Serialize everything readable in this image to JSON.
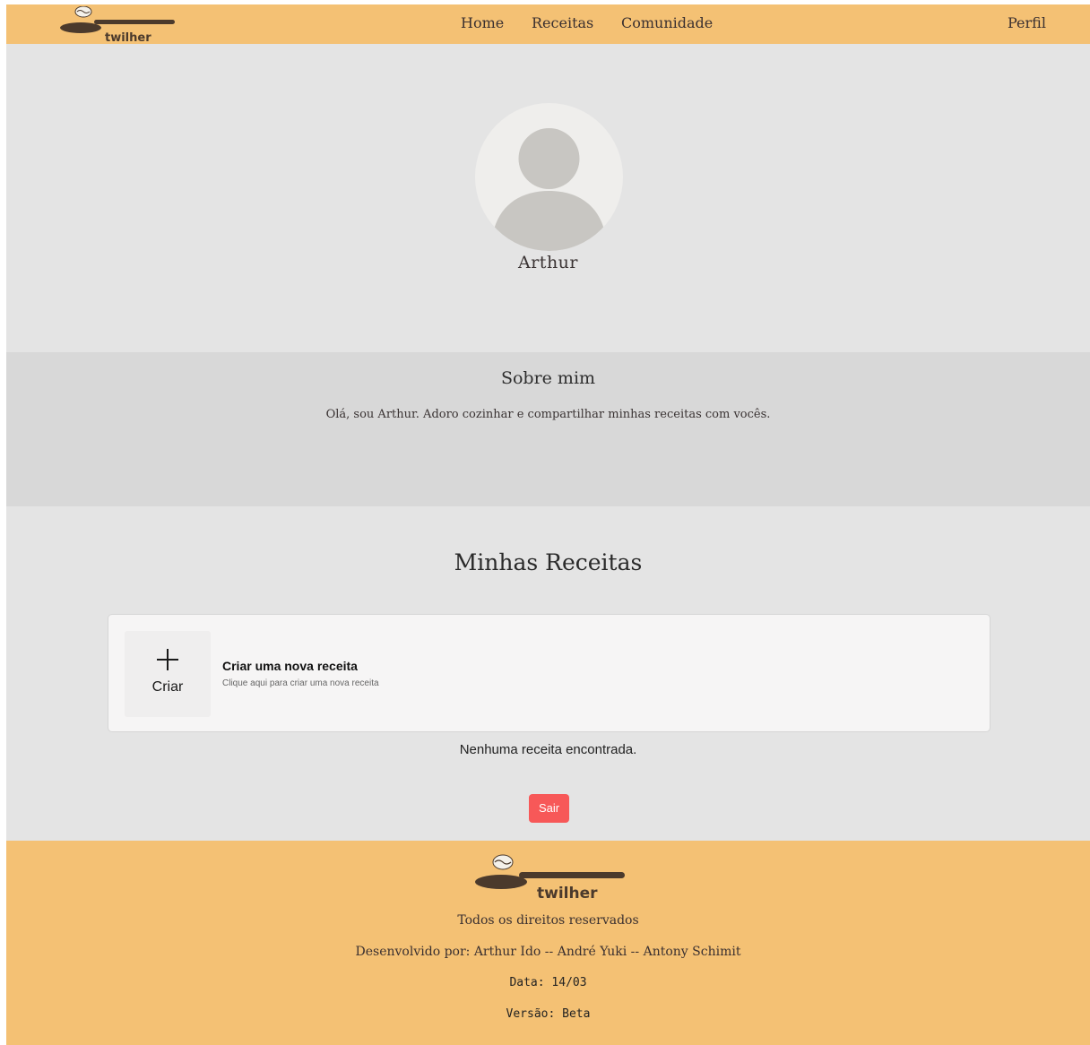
{
  "header": {
    "logo_text": "twilher",
    "nav": {
      "home": "Home",
      "receitas": "Receitas",
      "comunidade": "Comunidade",
      "perfil": "Perfil"
    }
  },
  "profile": {
    "name": "Arthur"
  },
  "about": {
    "title": "Sobre mim",
    "text": "Olá, sou Arthur. Adoro cozinhar e compartilhar minhas receitas com vocês."
  },
  "recipes": {
    "title": "Minhas Receitas",
    "create_card": {
      "tile_label": "Criar",
      "title": "Criar uma nova receita",
      "subtitle": "Clique aqui para criar uma nova receita"
    },
    "empty_message": "Nenhuma receita encontrada.",
    "logout_label": "Sair"
  },
  "footer": {
    "logo_text": "twilher",
    "rights": "Todos os direitos reservados",
    "developers": "Desenvolvido por: Arthur Ido -- André Yuki -- Antony Schimit",
    "date": "Data: 14/03",
    "version": "Versão: Beta"
  },
  "colors": {
    "header_footer_bg": "#f4c174",
    "page_bg": "#e4e4e4",
    "about_bg": "#d8d8d8",
    "logout_button": "#f75858",
    "logo_brown": "#4b3a2c"
  },
  "icons": {
    "create": "plus-icon",
    "avatar": "user-silhouette-icon"
  }
}
